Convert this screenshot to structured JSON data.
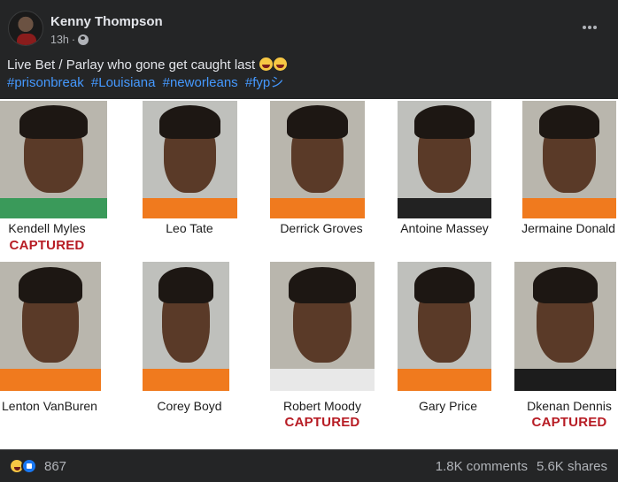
{
  "post": {
    "author": "Kenny Thompson",
    "time": "13h",
    "separator": "·",
    "caption": "Live Bet / Parlay who gone get caught last",
    "hashtags": [
      "#prisonbreak",
      "#Louisiana",
      "#neworleans",
      "#fypシ"
    ]
  },
  "image": {
    "status_label": "CAPTURED",
    "row1": [
      {
        "name": "Kendell Myles",
        "captured": true,
        "shirt": "#3a9a5a"
      },
      {
        "name": "Leo Tate",
        "captured": false,
        "shirt": "#f07a1e"
      },
      {
        "name": "Derrick Groves",
        "captured": false,
        "shirt": "#f07a1e"
      },
      {
        "name": "Antoine Massey",
        "captured": false,
        "shirt": "#222222"
      },
      {
        "name": "Jermaine Donald",
        "captured": false,
        "shirt": "#f07a1e"
      }
    ],
    "row2": [
      {
        "name": "Lenton VanBuren",
        "captured": false,
        "shirt": "#f07a1e"
      },
      {
        "name": "Corey Boyd",
        "captured": false,
        "shirt": "#f07a1e"
      },
      {
        "name": "Robert Moody",
        "captured": true,
        "shirt": "#e8e8e8"
      },
      {
        "name": "Gary Price",
        "captured": false,
        "shirt": "#f07a1e"
      },
      {
        "name": "Dkenan Dennis",
        "captured": true,
        "shirt": "#1c1c1c"
      }
    ]
  },
  "footer": {
    "reaction_icons": [
      "haha-icon",
      "like-icon"
    ],
    "reaction_count": "867",
    "comments": "1.8K comments",
    "shares": "5.6K shares"
  },
  "colors": {
    "background": "#242526",
    "hashtag": "#4599ff",
    "captured": "#b71c24"
  }
}
